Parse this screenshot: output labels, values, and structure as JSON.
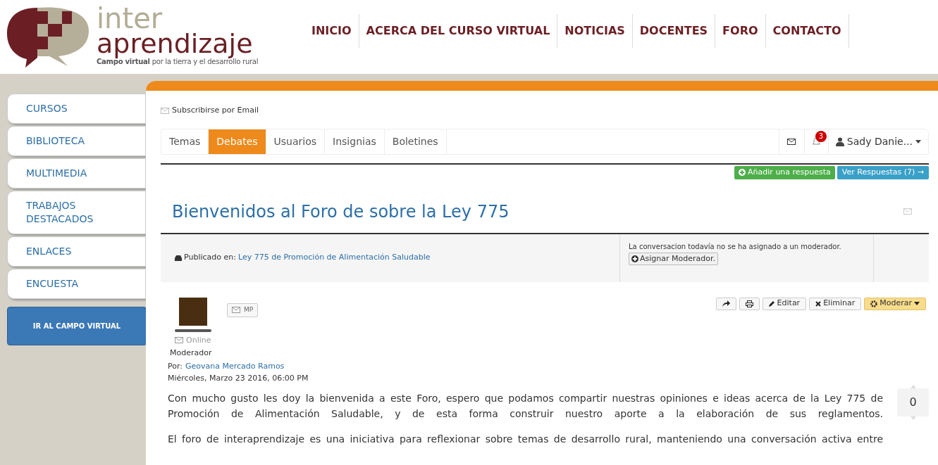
{
  "logo": {
    "word_1": "inter",
    "word_2": "aprendizaje",
    "tagline_bold": "Campo virtual",
    "tagline": "por la tierra y el desarrollo rural"
  },
  "nav": [
    "INICIO",
    "ACERCA DEL CURSO VIRTUAL",
    "NOTICIAS",
    "DOCENTES",
    "FORO",
    "CONTACTO"
  ],
  "sidebar": {
    "items": [
      "CURSOS",
      "BIBLIOTECA",
      "MULTIMEDIA",
      "TRABAJOS DESTACADOS",
      "ENLACES",
      "ENCUESTA"
    ],
    "button": "IR AL CAMPO VIRTUAL"
  },
  "subscribe": "Subscribirse por Email",
  "tabs": [
    {
      "label": "Temas",
      "selected": false
    },
    {
      "label": "Debates",
      "selected": true
    },
    {
      "label": "Usuarios",
      "selected": false
    },
    {
      "label": "Insignias",
      "selected": false
    },
    {
      "label": "Boletines",
      "selected": false
    }
  ],
  "notifications": "3",
  "user": "Sady Danie...",
  "actions": {
    "add_reply": "Añadir una respuesta",
    "view_replies": "Ver Respuestas (7) →"
  },
  "topic": {
    "title": "Bienvenidos al Foro de sobre la Ley 775",
    "published_label": "Publicado en:",
    "published_in": "Ley 775 de Promoción de Alimentación Saludable",
    "moderator_note": "La conversacion todavía no se ha asignado a un moderador.",
    "assign_button": "Asignar Moderador."
  },
  "post": {
    "pm_button": "MP",
    "status": "Online",
    "role": "Moderador",
    "by_label": "Por:",
    "author": "Geovana Mercado Ramos",
    "date": "Miércoles, Marzo 23 2016, 06:00 PM",
    "tools": [
      {
        "kind": "share"
      },
      {
        "kind": "print"
      },
      {
        "kind": "edit",
        "label": "Editar"
      },
      {
        "kind": "delete",
        "label": "Eliminar"
      },
      {
        "kind": "moderate",
        "label": "Moderar"
      }
    ],
    "votes": "0",
    "paragraphs": [
      "Con mucho gusto les doy la bienvenida a este Foro, espero que podamos compartir nuestras opiniones e ideas acerca de la Ley 775 de Promoción de Alimentación Saludable, y de esta forma construir nuestro aporte a la elaboración de sus reglamentos.",
      "El foro de interaprendizaje es una iniciativa para reflexionar sobre temas de desarrollo rural, manteniendo una conversación activa entre"
    ]
  }
}
